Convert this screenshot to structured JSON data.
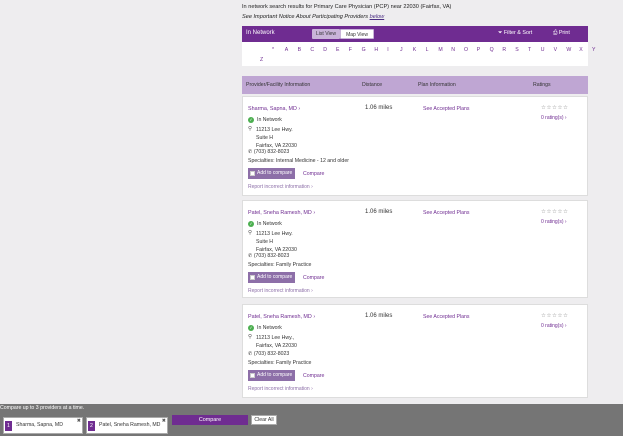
{
  "intro": {
    "line1": "In network search results for Primary Care Physician (PCP) near 22030 (Fairfax, VA)",
    "line2_prefix": "See Important Notice About Participating Providers ",
    "line2_link": "below"
  },
  "toolbar": {
    "title": "In Network",
    "list_view": "List View",
    "map_view": "Map View",
    "filter_sort": "Filter & Sort",
    "print": "Print"
  },
  "alphabet": [
    "*",
    "A",
    "B",
    "C",
    "D",
    "E",
    "F",
    "G",
    "H",
    "I",
    "J",
    "K",
    "L",
    "M",
    "N",
    "O",
    "P",
    "Q",
    "R",
    "S",
    "T",
    "U",
    "V",
    "W",
    "X",
    "Y",
    "Z"
  ],
  "table": {
    "col_provider": "Provider/Facility Information",
    "col_distance": "Distance",
    "col_plan": "Plan Information",
    "col_ratings": "Ratings"
  },
  "providers": [
    {
      "name": "Sharma, Sapna, MD",
      "network": "In Network",
      "addr1": "11213 Lee Hwy.",
      "addr2": "Suite H",
      "addr3": "Fairfax, VA 22030",
      "phone": "(703) 832-8023",
      "specialties": "Specialties: Internal Medicine - 12 and older",
      "distance": "1.06 miles",
      "plans": "See Accepted Plans",
      "stars": "☆☆☆☆☆",
      "ratings": "0 rating(s)",
      "add_compare": "Add to compare",
      "compare": "Compare",
      "report": "Report incorrect information"
    },
    {
      "name": "Patel, Sneha Ramesh, MD",
      "network": "In Network",
      "addr1": "11213 Lee Hwy.",
      "addr2": "Suite H",
      "addr3": "Fairfax, VA 22030",
      "phone": "(703) 832-8023",
      "specialties": "Specialties: Family Practice",
      "distance": "1.06 miles",
      "plans": "See Accepted Plans",
      "stars": "☆☆☆☆☆",
      "ratings": "0 rating(s)",
      "add_compare": "Add to compare",
      "compare": "Compare",
      "report": "Report incorrect information"
    },
    {
      "name": "Patel, Sneha Ramesh, MD",
      "network": "In Network",
      "addr1": "11213 Lee Hwy.,",
      "addr2": "Fairfax, VA 22030",
      "phone": "(703) 832-8023",
      "specialties": "Specialties: Family Practice",
      "distance": "1.06 miles",
      "plans": "See Accepted Plans",
      "stars": "☆☆☆☆☆",
      "ratings": "0 rating(s)",
      "add_compare": "Add to compare",
      "compare": "Compare",
      "report": "Report incorrect information"
    }
  ],
  "footer": {
    "caption": "Compare up to 3 providers at a time.",
    "slot1_num": "1",
    "slot1_name": "Sharma, Sapna, MD",
    "slot2_num": "2",
    "slot2_name": "Patel, Sneha Ramesh, MD",
    "compare": "Compare",
    "clear_all": "Clear All"
  },
  "colors": {
    "brand": "#6f2c91",
    "header_row": "#bfa6d3",
    "in_network": "#4caf50",
    "footer": "#757575"
  }
}
